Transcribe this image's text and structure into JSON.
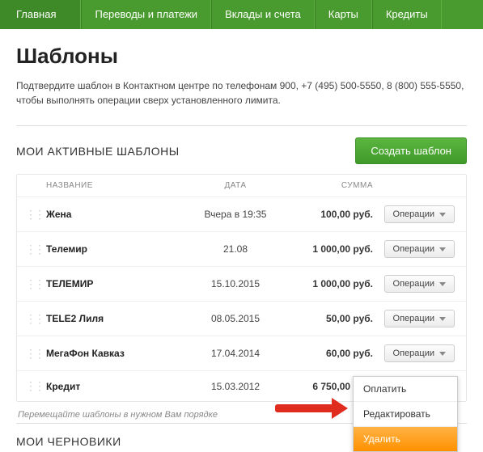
{
  "nav": {
    "items": [
      {
        "label": "Главная"
      },
      {
        "label": "Переводы и платежи"
      },
      {
        "label": "Вклады и счета"
      },
      {
        "label": "Карты"
      },
      {
        "label": "Кредиты"
      }
    ]
  },
  "page": {
    "title": "Шаблоны",
    "description": "Подтвердите шаблон в Контактном центре по телефонам 900, +7 (495) 500-5550, 8 (800) 555-5550, чтобы выполнять операции сверх установленного лимита."
  },
  "section": {
    "title": "МОИ АКТИВНЫЕ ШАБЛОНЫ",
    "create_label": "Создать шаблон",
    "cols": {
      "name": "НАЗВАНИЕ",
      "date": "ДАТА",
      "sum": "СУММА"
    },
    "ops_label": "Операции",
    "rows": [
      {
        "name": "Жена",
        "date": "Вчера в 19:35",
        "sum": "100,00 руб."
      },
      {
        "name": "Телемир",
        "date": "21.08",
        "sum": "1 000,00 руб."
      },
      {
        "name": "ТЕЛЕМИР",
        "date": "15.10.2015",
        "sum": "1 000,00 руб."
      },
      {
        "name": "TELE2 Лиля",
        "date": "08.05.2015",
        "sum": "50,00 руб."
      },
      {
        "name": "МегаФон Кавказ",
        "date": "17.04.2014",
        "sum": "60,00 руб."
      },
      {
        "name": "Кредит",
        "date": "15.03.2012",
        "sum": "6 750,00 руб."
      }
    ]
  },
  "dropdown": {
    "pay": "Оплатить",
    "edit": "Редактировать",
    "delete": "Удалить"
  },
  "hint": "Перемещайте шаблоны в нужном Вам порядке",
  "drafts_title": "МОИ ЧЕРНОВИКИ"
}
